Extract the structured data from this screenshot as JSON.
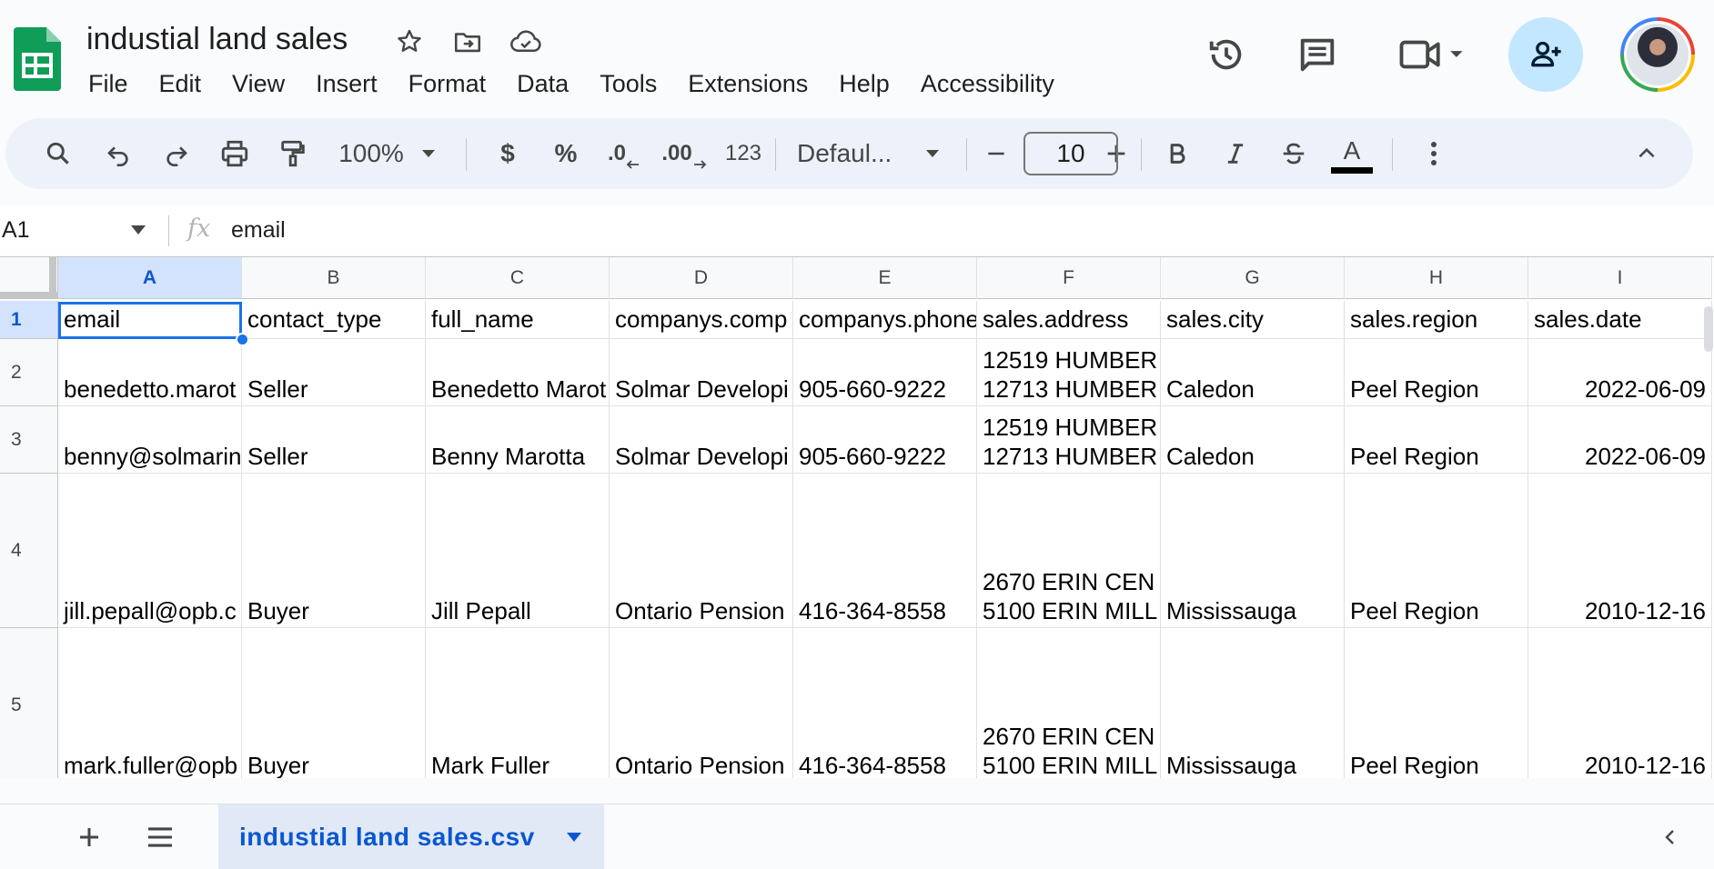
{
  "document": {
    "title": "industial land sales",
    "menu": [
      "File",
      "Edit",
      "View",
      "Insert",
      "Format",
      "Data",
      "Tools",
      "Extensions",
      "Help",
      "Accessibility"
    ]
  },
  "icons": {
    "title_icons": [
      "star-icon",
      "move-to-folder-icon",
      "cloud-saved-icon"
    ],
    "header_actions": [
      "version-history-icon",
      "comments-icon",
      "meet-icon",
      "share-icon",
      "avatar"
    ]
  },
  "toolbar": {
    "zoom": "100%",
    "currency": "$",
    "percent": "%",
    "decrease_decimal": ".0",
    "increase_decimal": ".00",
    "number_format": "123",
    "font_family": "Defaul...",
    "font_size": "10",
    "text_color": "A",
    "text_color_value": "#000000"
  },
  "formula_bar": {
    "cell_ref": "A1",
    "content": "email"
  },
  "grid": {
    "columns": [
      "A",
      "B",
      "C",
      "D",
      "E",
      "F",
      "G",
      "H",
      "I"
    ],
    "selected_column": "A",
    "row_numbers": [
      "1",
      "2",
      "3",
      "4",
      "5"
    ],
    "selected_row": "1",
    "rows": [
      {
        "email": "email",
        "contact_type": "contact_type",
        "full_name": "full_name",
        "company": "companys.comp",
        "phone": "companys.phone",
        "address_1": "sales.address",
        "address_2": "",
        "city": "sales.city",
        "region": "sales.region",
        "date": "sales.date"
      },
      {
        "email": "benedetto.marot",
        "contact_type": "Seller",
        "full_name": "Benedetto Marot",
        "company": "Solmar Developi",
        "phone": "905-660-9222",
        "address_1": "12519 HUMBER",
        "address_2": "12713 HUMBER",
        "city": "Caledon",
        "region": "Peel Region",
        "date": "2022-06-09"
      },
      {
        "email": "benny@solmarin",
        "contact_type": "Seller",
        "full_name": "Benny Marotta",
        "company": "Solmar Developi",
        "phone": "905-660-9222",
        "address_1": "12519 HUMBER",
        "address_2": "12713 HUMBER",
        "city": "Caledon",
        "region": "Peel Region",
        "date": "2022-06-09"
      },
      {
        "email": "jill.pepall@opb.c",
        "contact_type": "Buyer",
        "full_name": "Jill Pepall",
        "company": "Ontario Pension",
        "phone": "416-364-8558",
        "address_1": "2670 ERIN CEN",
        "address_2": "5100 ERIN MILL",
        "city": "Mississauga",
        "region": "Peel Region",
        "date": "2010-12-16"
      },
      {
        "email": "mark.fuller@opb",
        "contact_type": "Buyer",
        "full_name": "Mark Fuller",
        "company": "Ontario Pension",
        "phone": "416-364-8558",
        "address_1": "2670 ERIN CEN",
        "address_2": "5100 ERIN MILL",
        "city": "Mississauga",
        "region": "Peel Region",
        "date": "2010-12-16"
      }
    ]
  },
  "sheets": {
    "active_tab": "industial land sales.csv"
  },
  "colors": {
    "accent": "#0b57d0",
    "selection": "#1a73e8",
    "selected_header": "#d3e3fd",
    "share_button": "#c2e7ff",
    "sheets_green": "#0f9d58"
  }
}
